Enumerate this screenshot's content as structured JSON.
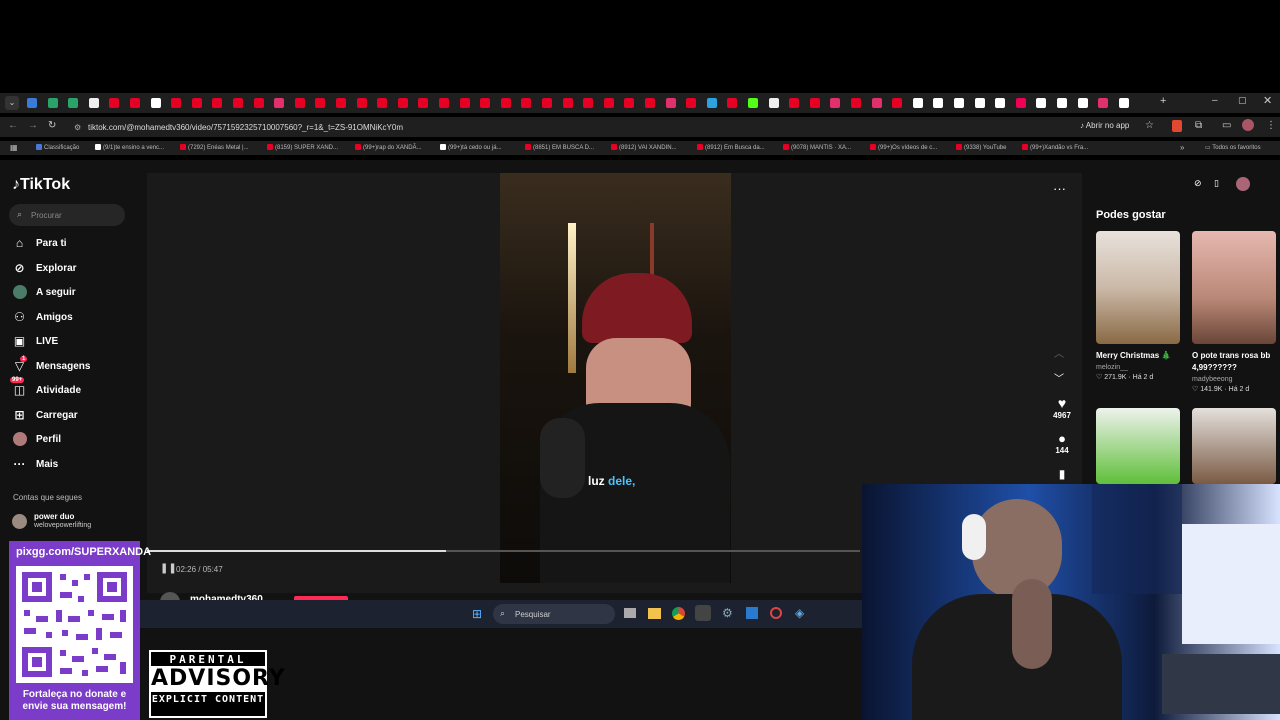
{
  "browser": {
    "url": "tiktok.com/@mohamedtv360/video/7571592325710007560?_r=1&_t=ZS-91OMNiKcY0m",
    "open_app_label": "Abrir no app",
    "bookmarks": [
      "Classificação",
      "(9/1)te ensino a venc...",
      "(7292) Enéas Metal |...",
      "(8159) SUPER XAND...",
      "(99+)rap do XANDÃ...",
      "(99+)tá cedo ou já...",
      "(8851) EM BUSCA D...",
      "(8912) VAI XANDIN...",
      "(8912) Em Busca da...",
      "(9078) MANTIS · XA...",
      "(99+)Os vídeos de c...",
      "(9338) YouTube",
      "(99+)Xandão vs Fra..."
    ],
    "all_favorites": "Todos os favoritos"
  },
  "tiktok": {
    "logo": "TikTok",
    "search_placeholder": "Procurar",
    "nav": [
      "Para ti",
      "Explorar",
      "A seguir",
      "Amigos",
      "LIVE",
      "Mensagens",
      "Atividade",
      "Carregar",
      "Perfil",
      "Mais"
    ],
    "messages_badge": "1",
    "activity_badge": "99+",
    "following_section": "Contas que segues",
    "following_account": {
      "name": "power duo",
      "handle": "welovepowerlifting"
    },
    "video": {
      "caption_word": "luz",
      "caption_highlight": "dele,",
      "time": "02:26 / 05:47",
      "author": "mohamedtv360",
      "progress": 0.42
    },
    "actions": {
      "likes": "4967",
      "comments": "144"
    },
    "suggestions_title": "Podes gostar",
    "suggestions": [
      {
        "title": "Merry Christmas 🎄",
        "author": "melozin__",
        "likes": "271.9K",
        "age": "Há 2 d"
      },
      {
        "title": "O pote trans rosa bb 4,99??????",
        "author": "madybeeong",
        "likes": "141.9K",
        "age": "Há 2 d"
      }
    ]
  },
  "taskbar": {
    "search_label": "Pesquisar"
  },
  "overlay": {
    "qr_url": "pixgg.com/SUPERXANDA",
    "qr_text_1": "Fortaleça no donate e",
    "qr_text_2": "envie sua mensagem!",
    "advisory_1": "PARENTAL",
    "advisory_2": "ADVISORY",
    "advisory_3": "EXPLICIT CONTENT"
  }
}
